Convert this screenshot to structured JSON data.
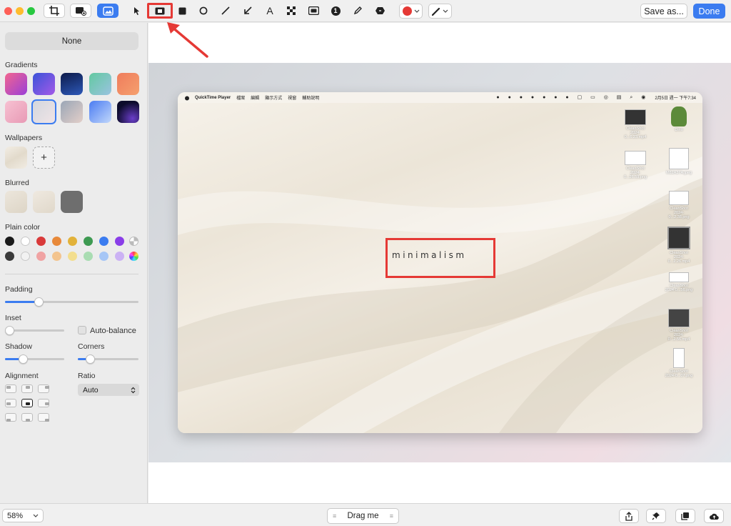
{
  "toolbar": {
    "save_as_label": "Save as...",
    "done_label": "Done",
    "text_tool_glyph": "A",
    "counter_tool_glyph": "1",
    "active_tool": "rectangle-highlight",
    "color_accent": "#e53935"
  },
  "sidebar": {
    "background_none_label": "None",
    "gradients_label": "Gradients",
    "wallpapers_label": "Wallpapers",
    "wallpaper_add_glyph": "+",
    "blurred_label": "Blurred",
    "plain_color_label": "Plain color",
    "padding_label": "Padding",
    "padding_value": 0.25,
    "inset_label": "Inset",
    "inset_value": 0.0,
    "auto_balance_label": "Auto-balance",
    "shadow_label": "Shadow",
    "shadow_value": 0.3,
    "corners_label": "Corners",
    "corners_value": 0.2,
    "alignment_label": "Alignment",
    "alignment_selected": "center",
    "ratio_label": "Ratio",
    "ratio_value": "Auto",
    "colors_row1": [
      "#1a1a1a",
      "#ffffff",
      "#d93a3a",
      "#e8893a",
      "#e2b23a",
      "#3e9a52",
      "#3b7cf0",
      "#8a3ee8"
    ],
    "colors_row2": [
      "#3a3a3a",
      "#f2f2f2",
      "#f0a3a3",
      "#f3c48e",
      "#f3de8e",
      "#a9dcb2",
      "#a6c6f6",
      "#cbb2f4"
    ]
  },
  "screenshot": {
    "menubar_app": "QuickTime Player",
    "menubar_items": [
      "檔案",
      "編輯",
      "顯示方式",
      "視窗",
      "輔助說明"
    ],
    "menubar_clock": "2月5日 週一 下午7:34",
    "wallpaper_text": "minimalism",
    "desktop_icons": [
      {
        "label1": "CleanShot",
        "label2": "2024-0...6.23.mp4"
      },
      {
        "label1": "Dino",
        "label2": ""
      },
      {
        "label1": "CleanShot",
        "label2": "2024-0...26.59.png"
      },
      {
        "label1": "M82A37A.jpeg",
        "label2": ""
      },
      {
        "label1": "CleanShot",
        "label2": "2024-0...2.38.png"
      },
      {
        "label1": "CleanShot",
        "label2": "2024-0...2.26.mp4"
      },
      {
        "label1": "CleanShot",
        "label2": "2024-0...56.png"
      },
      {
        "label1": "CleanShot",
        "label2": "2024-0...2.56.mp4"
      },
      {
        "label1": "CleanShot",
        "label2": "2024-0...07.png"
      }
    ]
  },
  "bottombar": {
    "zoom_label": "58%",
    "drag_label": "Drag me"
  }
}
